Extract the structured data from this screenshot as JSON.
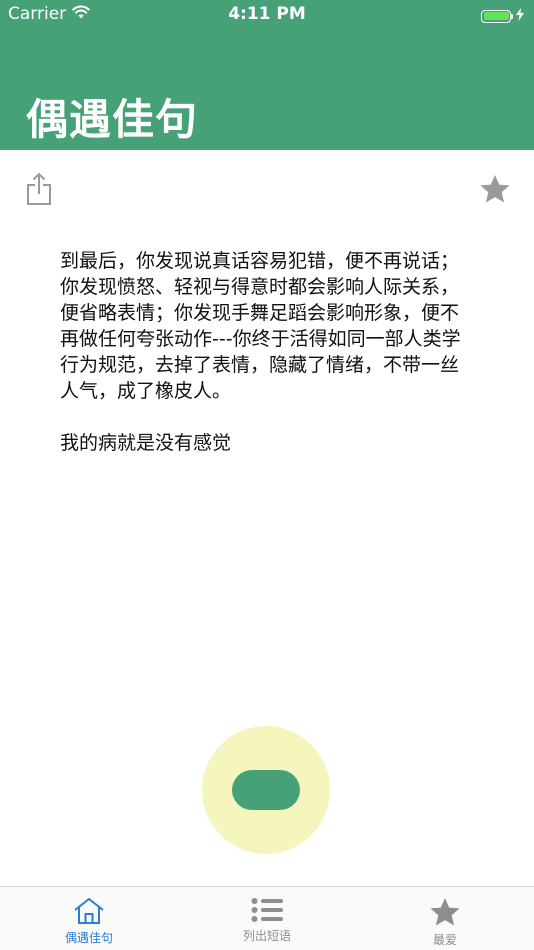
{
  "status_bar": {
    "carrier": "Carrier",
    "time": "4:11 PM",
    "battery_level": 1.0
  },
  "header": {
    "title": "偶遇佳句"
  },
  "toolbar": {
    "share_icon": "share-icon",
    "favorite_icon": "star-icon"
  },
  "quote": {
    "text": "到最后，你发现说真话容易犯错，便不再说话；你发现愤怒、轻视与得意时都会影响人际关系，便省略表情；你发现手舞足蹈会影响形象，便不再做任何夸张动作---你终于活得如同一部人类学行为规范，去掉了表情，隐藏了情绪，不带一丝人气，成了橡皮人。\n\n我的病就是没有感觉"
  },
  "tabs": [
    {
      "label": "偶遇佳句",
      "icon": "home-icon",
      "active": true
    },
    {
      "label": "列出短语",
      "icon": "list-icon",
      "active": false
    },
    {
      "label": "最爱",
      "icon": "star-icon",
      "active": false
    }
  ],
  "colors": {
    "brand_green": "#46a179",
    "fab_ring": "#f5f6bd",
    "tab_active": "#2a7fd4",
    "tab_inactive": "#8e8e8e",
    "toolbar_icon": "#9a9a9a"
  }
}
